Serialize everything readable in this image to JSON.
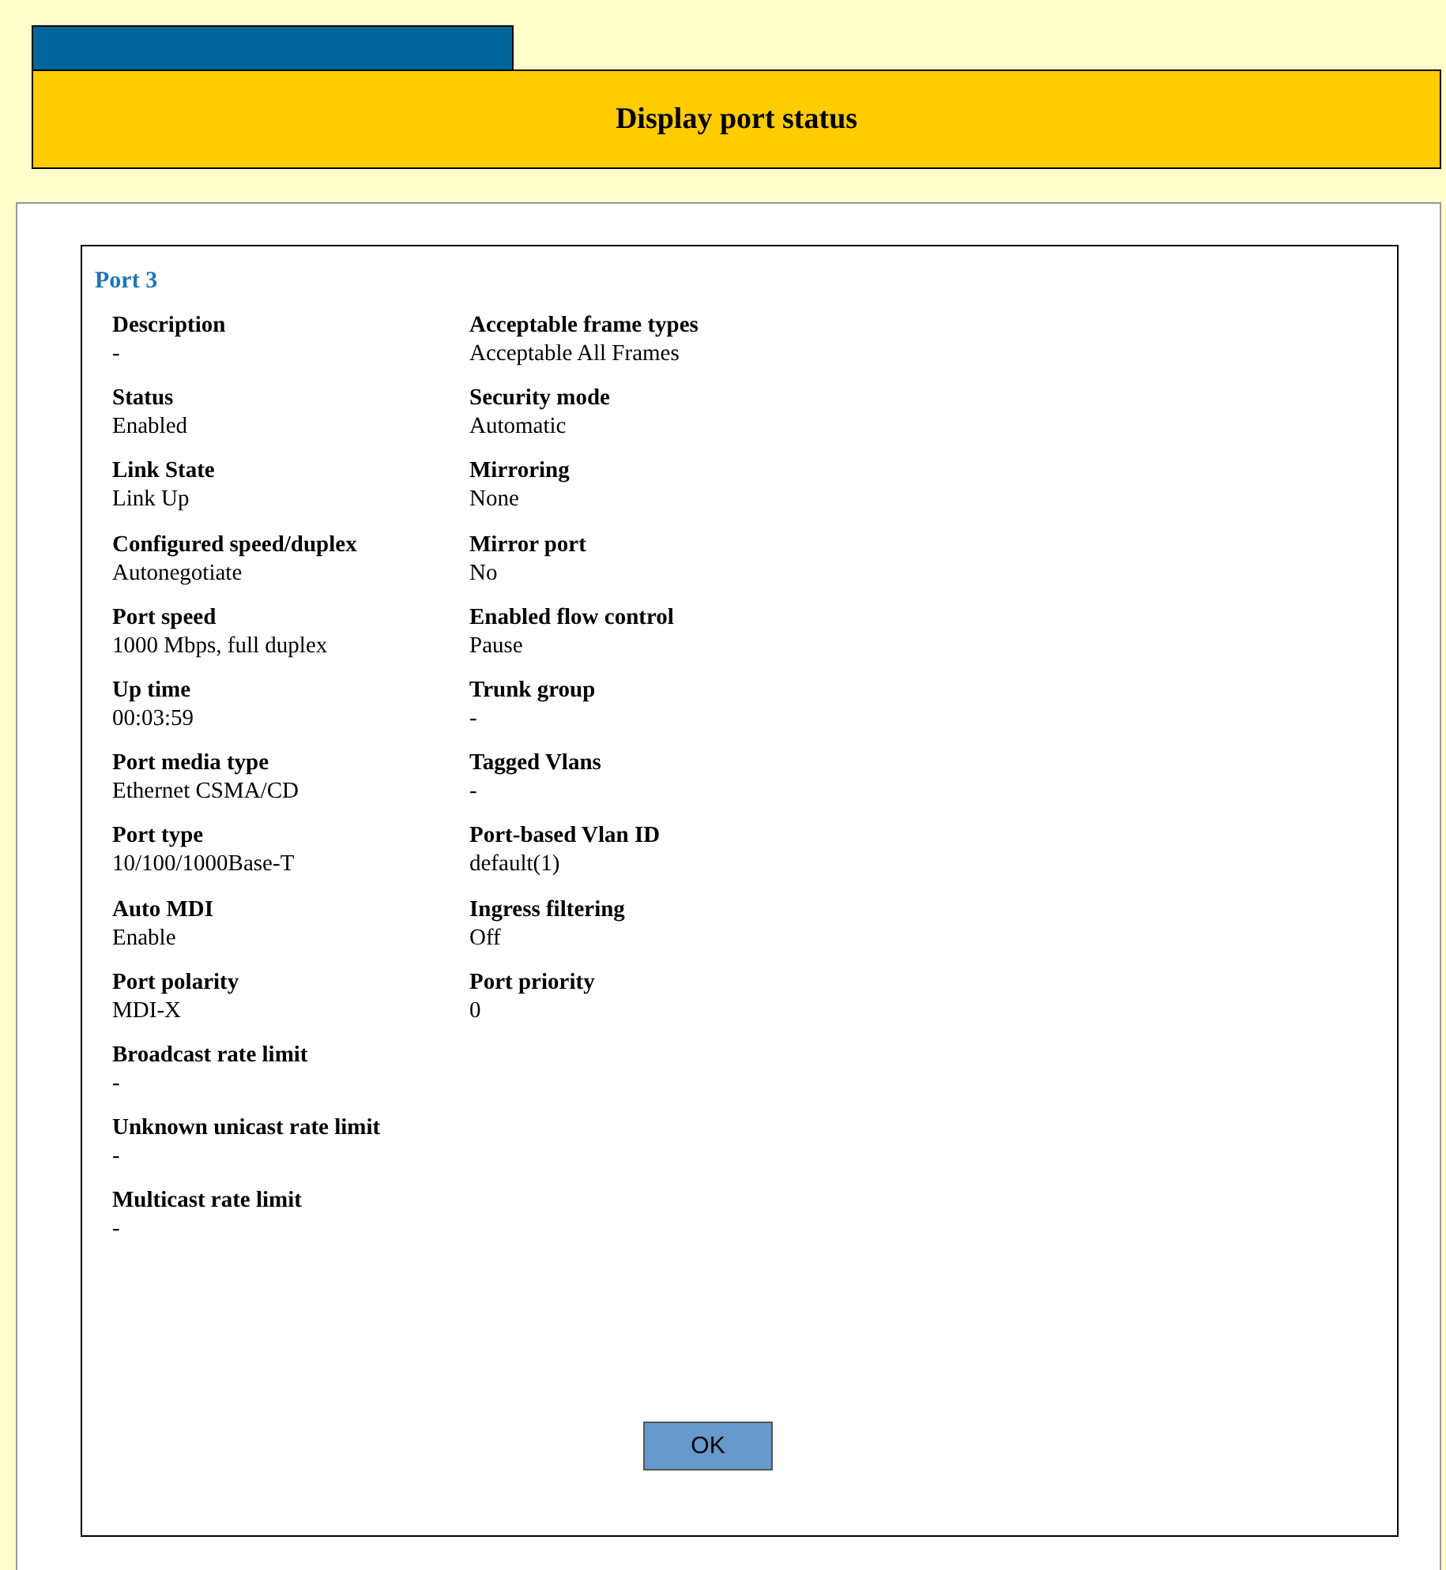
{
  "header": {
    "title": "Display port status"
  },
  "port": {
    "title": "Port 3"
  },
  "columns": [
    [
      {
        "label": "Description",
        "value": "-"
      },
      {
        "label": "Status",
        "value": "Enabled"
      },
      {
        "label": "Link State",
        "value": "Link Up"
      },
      {
        "label": "Configured speed/duplex",
        "value": "Autonegotiate"
      },
      {
        "label": "Port speed",
        "value": "1000 Mbps, full duplex"
      },
      {
        "label": "Up time",
        "value": "00:03:59"
      },
      {
        "label": "Port media type",
        "value": "Ethernet CSMA/CD"
      },
      {
        "label": "Port type",
        "value": "10/100/1000Base-T"
      },
      {
        "label": "Auto MDI",
        "value": "Enable"
      },
      {
        "label": "Port polarity",
        "value": "MDI-X"
      },
      {
        "label": "Broadcast rate limit",
        "value": "-"
      },
      {
        "label": "Unknown unicast rate limit",
        "value": "-"
      },
      {
        "label": "Multicast rate limit",
        "value": "-"
      }
    ],
    [
      {
        "label": "Acceptable frame types",
        "value": "Acceptable All Frames"
      },
      {
        "label": "Security mode",
        "value": "Automatic"
      },
      {
        "label": "Mirroring",
        "value": "None"
      },
      {
        "label": "Mirror port",
        "value": "No"
      },
      {
        "label": "Enabled flow control",
        "value": "Pause"
      },
      {
        "label": "Trunk group",
        "value": "-"
      },
      {
        "label": "Tagged Vlans",
        "value": "-"
      },
      {
        "label": "Port-based Vlan ID",
        "value": "default(1)"
      },
      {
        "label": "Ingress filtering",
        "value": "Off"
      },
      {
        "label": "Port priority",
        "value": "0"
      }
    ]
  ],
  "buttons": [
    "OK"
  ]
}
